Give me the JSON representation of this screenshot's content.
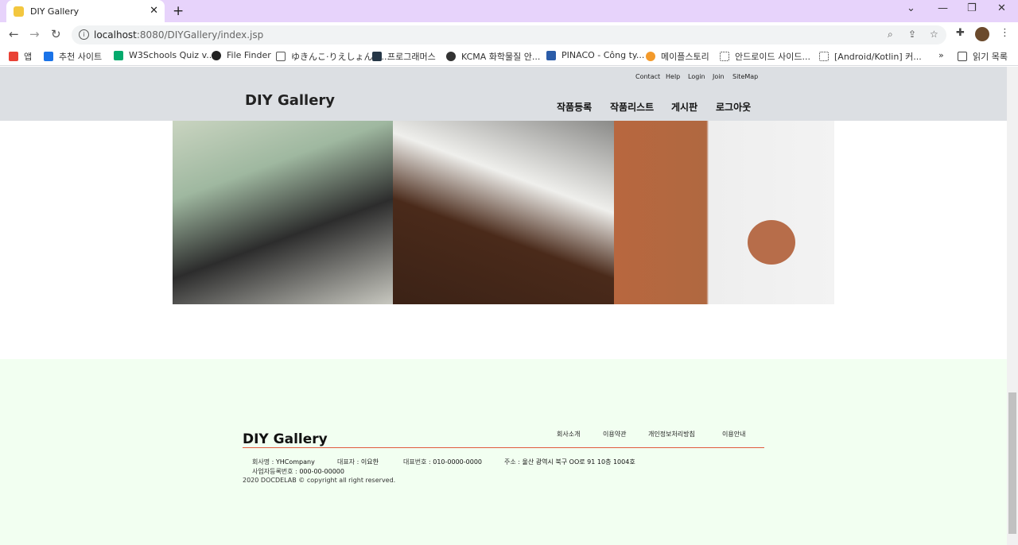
{
  "browser": {
    "tab_title": "DIY Gallery",
    "url_host": "localhost",
    "url_path": ":8080/DIYGallery/index.jsp",
    "bookmarks": [
      {
        "label": "앱",
        "color": "#e94235"
      },
      {
        "label": "추천 사이트",
        "color": "#1a73e8"
      },
      {
        "label": "W3Schools Quiz v...",
        "color": "#04aa6d"
      },
      {
        "label": "File Finder",
        "color": "#222222"
      },
      {
        "label": "ゆきんこ·りえしょんの...",
        "color": "#555555"
      },
      {
        "label": "프로그래머스",
        "color": "#263747"
      },
      {
        "label": "KCMA 화학물질 안...",
        "color": "#333333"
      },
      {
        "label": "PINACO - Công ty...",
        "color": "#2b5ca8"
      },
      {
        "label": "메이플스토리",
        "color": "#f39a2b"
      },
      {
        "label": "안드로이드 사이드...",
        "color": "#333333"
      },
      {
        "label": "[Android/Kotlin] 커...",
        "color": "#333333"
      }
    ],
    "more_bookmarks": "»",
    "reading_list": "읽기 목록"
  },
  "site": {
    "logo": "DIY Gallery",
    "util_links": [
      "Contact",
      "Help",
      "Login",
      "Join",
      "SiteMap"
    ],
    "main_nav": [
      "작품등록",
      "작품리스트",
      "게시판",
      "로그아웃"
    ]
  },
  "footer": {
    "logo": "DIY Gallery",
    "links": [
      "회사소개",
      "이용약관",
      "개인정보처리방침",
      "이용안내"
    ],
    "company_label": "회사명 : ",
    "company_value": "YHCompany",
    "ceo_label": "대표자 : ",
    "ceo_value": "이요한",
    "phone_label": "대표번호 : ",
    "phone_value": "010-0000-0000",
    "address_label": "주소 : ",
    "address_value": "울산 광역시 북구 OO로 91 10층 1004호",
    "bizno_label": "사업자등록번호 : ",
    "bizno_value": "000-00-00000",
    "copyright": "2020 DOCDELAB © copyright all right reserved."
  }
}
